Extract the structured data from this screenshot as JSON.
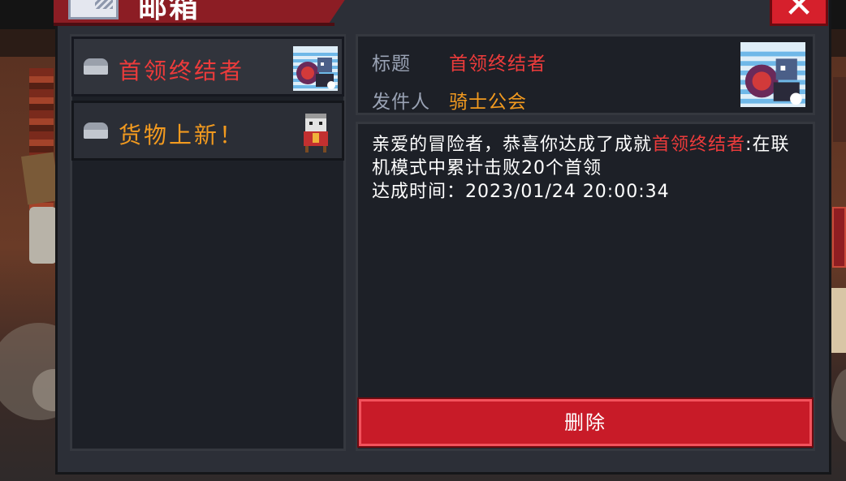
{
  "dialog": {
    "title": "邮箱",
    "close_label": "✕",
    "colors": {
      "panel": "#1d2027",
      "accent_red": "#ec3b3b",
      "accent_orange": "#f29a1f",
      "button_red": "#c81b28"
    }
  },
  "mail_list": [
    {
      "subject": "首领终结者",
      "color": "#ec3b3b",
      "selected": true,
      "thumb": "boss-portrait-icon"
    },
    {
      "subject": "货物上新！",
      "color": "#f29a1f",
      "selected": false,
      "thumb": "merchant-portrait-icon"
    }
  ],
  "detail": {
    "title_label": "标题",
    "title_value": "首领终结者",
    "sender_label": "发件人",
    "sender_value": "骑士公会",
    "thumb": "boss-portrait-icon",
    "body_prefix": "亲爱的冒险者，恭喜你达成了成就",
    "body_highlight": "首领终结者",
    "body_suffix": ":在联机模式中累计击败20个首领",
    "time_line": "达成时间：2023/01/24 20:00:34"
  },
  "actions": {
    "delete_label": "删除"
  }
}
